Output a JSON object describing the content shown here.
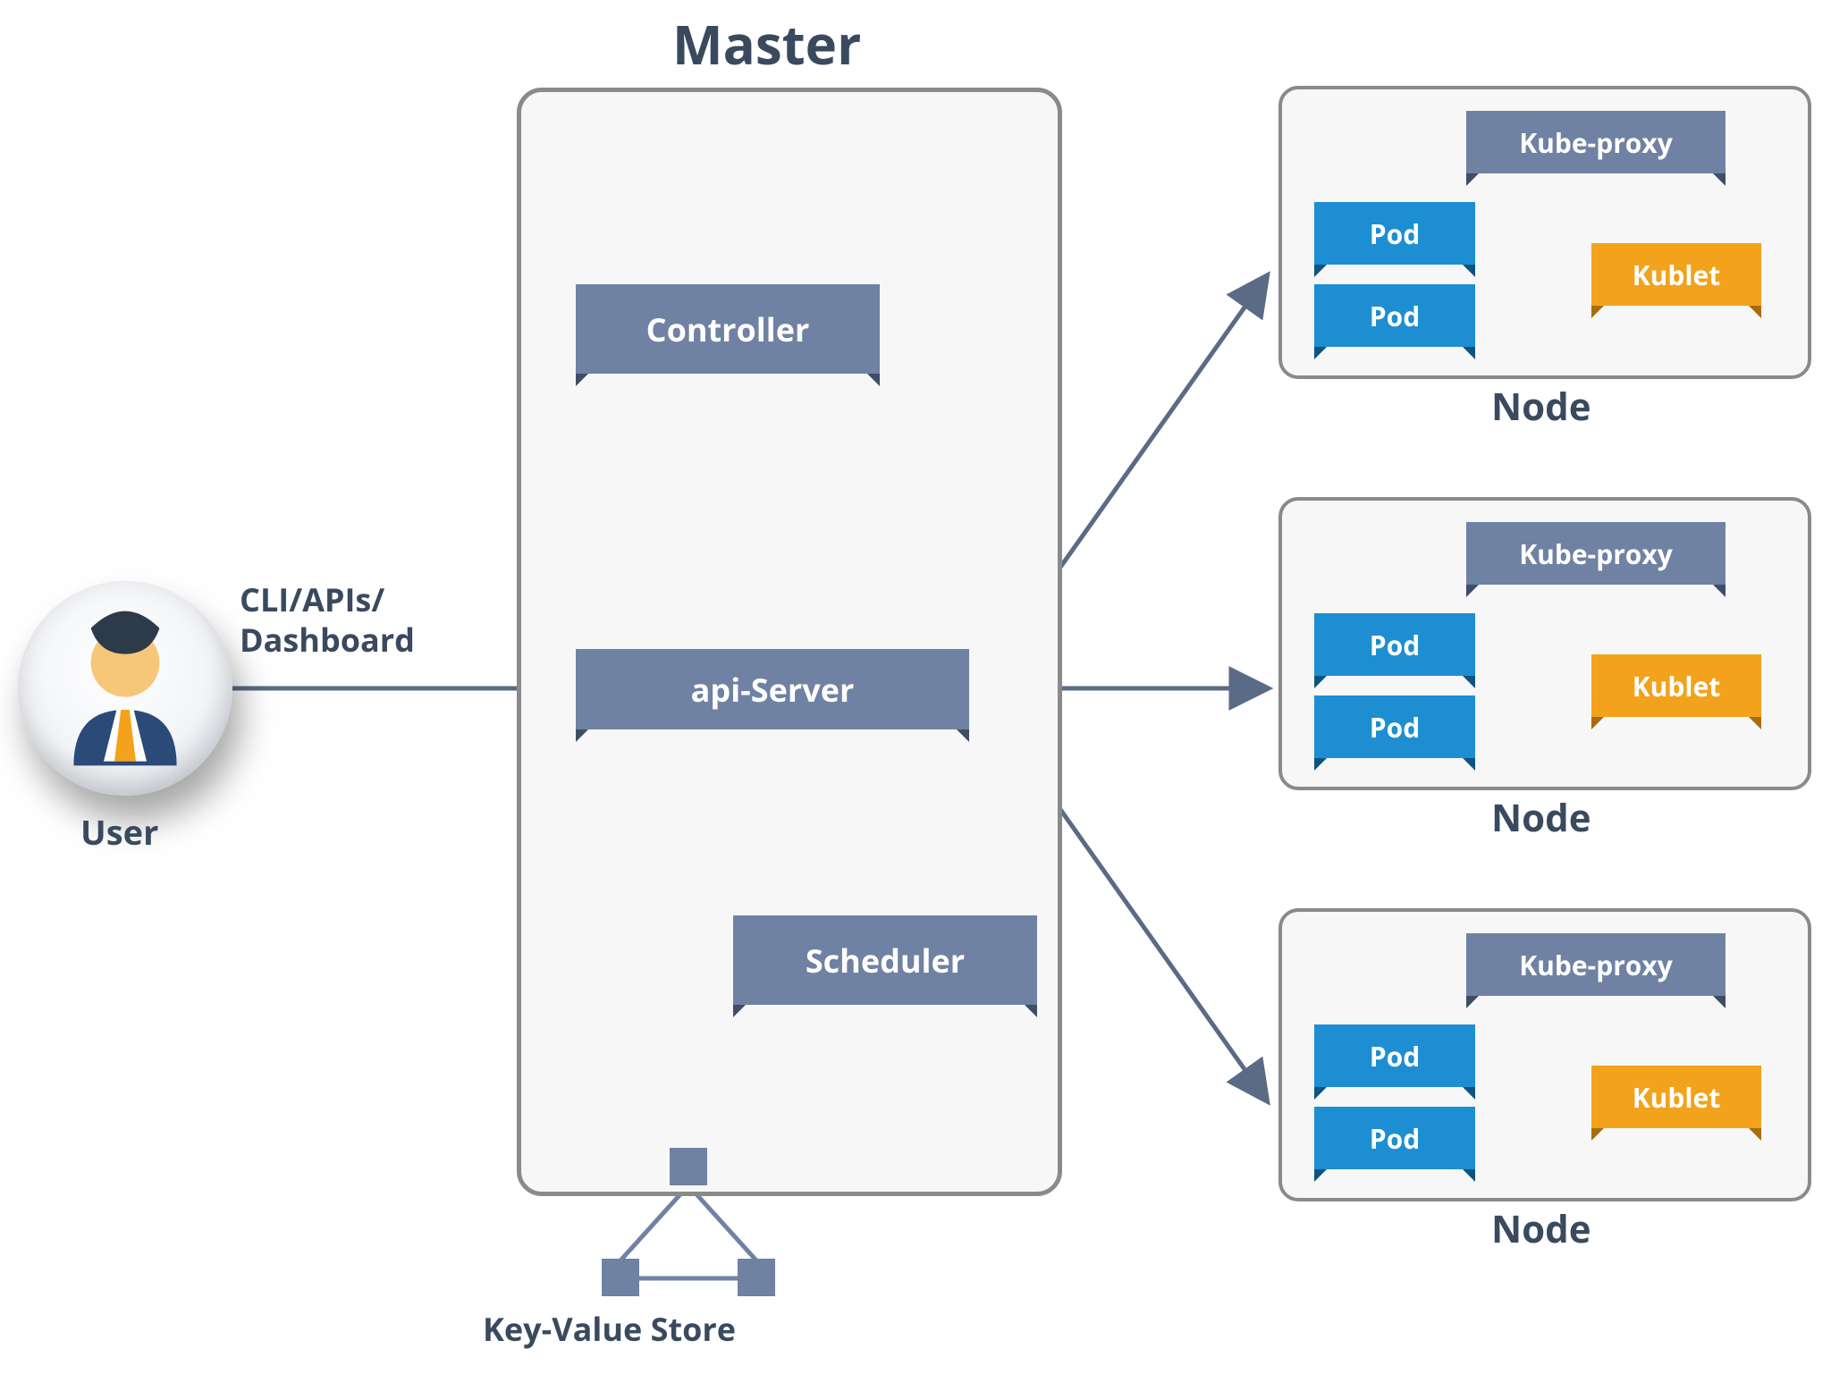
{
  "titles": {
    "master": "Master",
    "user": "User",
    "node": "Node",
    "kvs": "Key-Value Store"
  },
  "edge_label": {
    "line1": "CLI/APIs/",
    "line2": "Dashboard"
  },
  "master": {
    "controller": "Controller",
    "api_server": "api-Server",
    "scheduler": "Scheduler"
  },
  "node_template": {
    "kube_proxy": "Kube-proxy",
    "pod": "Pod",
    "kublet": "Kublet"
  },
  "nodes_count": 3,
  "colors": {
    "slate": "#6f82a3",
    "blue": "#1e8ed2",
    "orange": "#f2a31b",
    "border": "#8a8a8a",
    "text": "#3a4a5e",
    "arrow": "#5a6b85"
  }
}
